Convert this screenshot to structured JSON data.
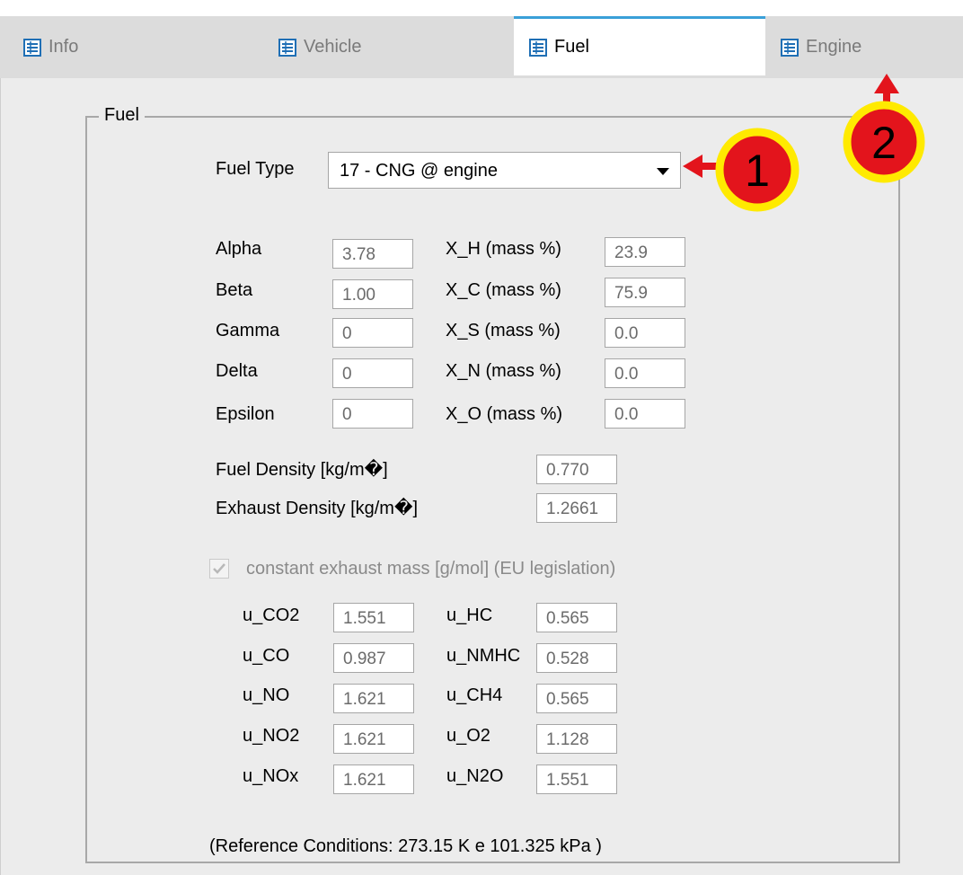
{
  "tabs": [
    {
      "label": "Info",
      "active": false
    },
    {
      "label": "Vehicle",
      "active": false
    },
    {
      "label": "Fuel",
      "active": true
    },
    {
      "label": "Engine",
      "active": false
    }
  ],
  "group": {
    "title": "Fuel"
  },
  "fuel_type": {
    "label": "Fuel Type",
    "value": "17 - CNG @ engine"
  },
  "params": [
    {
      "label": "Alpha",
      "value": "3.78"
    },
    {
      "label": "Beta",
      "value": "1.00"
    },
    {
      "label": "Gamma",
      "value": "0"
    },
    {
      "label": "Delta",
      "value": "0"
    },
    {
      "label": "Epsilon",
      "value": "0"
    }
  ],
  "mass": [
    {
      "label": "X_H (mass %)",
      "value": "23.9"
    },
    {
      "label": "X_C (mass %)",
      "value": "75.9"
    },
    {
      "label": "X_S (mass %)",
      "value": "0.0"
    },
    {
      "label": "X_N (mass %)",
      "value": "0.0"
    },
    {
      "label": "X_O (mass %)",
      "value": "0.0"
    }
  ],
  "density": [
    {
      "label": "Fuel Density [kg/m�]",
      "value": "0.770"
    },
    {
      "label": "Exhaust Density [kg/m�]",
      "value": "1.2661"
    }
  ],
  "constant_mass": {
    "label": "constant exhaust mass [g/mol] (EU legislation)",
    "checked": true
  },
  "u_left": [
    {
      "label": "u_CO2",
      "value": "1.551"
    },
    {
      "label": "u_CO",
      "value": "0.987"
    },
    {
      "label": "u_NO",
      "value": "1.621"
    },
    {
      "label": "u_NO2",
      "value": "1.621"
    },
    {
      "label": "u_NOx",
      "value": "1.621"
    }
  ],
  "u_right": [
    {
      "label": "u_HC",
      "value": "0.565"
    },
    {
      "label": "u_NMHC",
      "value": "0.528"
    },
    {
      "label": "u_CH4",
      "value": "0.565"
    },
    {
      "label": "u_O2",
      "value": "1.128"
    },
    {
      "label": "u_N2O",
      "value": "1.551"
    }
  ],
  "reference_note": "(Reference Conditions: 273.15 K e 101.325 kPa )",
  "annotations": [
    {
      "number": "1"
    },
    {
      "number": "2"
    }
  ],
  "colors": {
    "annotation_fill": "#e3141c",
    "annotation_ring": "#ffea00",
    "tab_accent": "#3aa0d8"
  }
}
